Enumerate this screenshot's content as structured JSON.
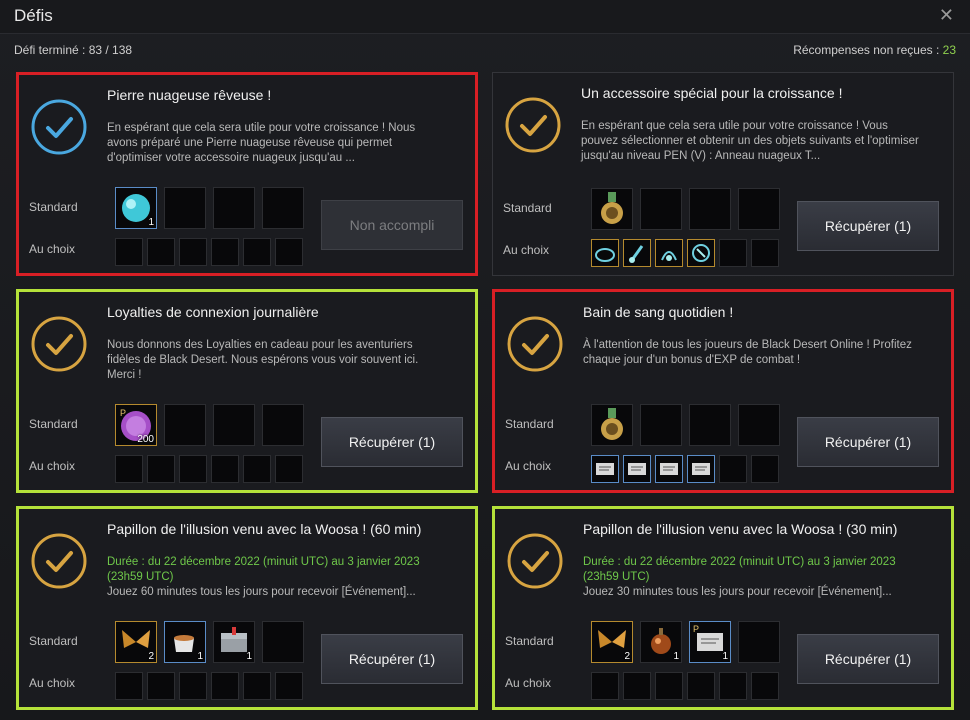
{
  "window": {
    "title": "Défis",
    "close_icon": "close-icon"
  },
  "status": {
    "completed": "Défi terminé : 83 / 138",
    "unclaimed_label": "Récompenses non reçues : ",
    "unclaimed_count": "23"
  },
  "labels": {
    "standard": "Standard",
    "choice": "Au choix"
  },
  "colors": {
    "highlight_red": "#d81f25",
    "highlight_green": "#b5e23a",
    "check_gold": "#d7a441",
    "check_blue": "#4aa8e0",
    "duration_green": "#6fc84a"
  },
  "cards": [
    {
      "title": "Pierre nuageuse rêveuse !",
      "desc": "En espérant que cela sera utile pour votre croissance ! Nous avons préparé une Pierre nuageuse rêveuse qui permet d'optimiser votre accessoire nuageux jusqu'au ...",
      "button": "Non accompli",
      "standard_items": [
        {
          "icon": "cloud-stone-icon",
          "qty": "1"
        }
      ],
      "choice_items": []
    },
    {
      "title": "Un accessoire spécial pour la croissance !",
      "desc": "En espérant que cela sera utile pour votre croissance ! Vous pouvez sélectionner et obtenir un des objets suivants et l'optimiser jusqu'au niveau PEN (V) : Anneau nuageux T...",
      "button": "Récupérer (1)",
      "standard_items": [
        {
          "icon": "medal-icon",
          "qty": ""
        }
      ],
      "choice_items": [
        {
          "icon": "ring-icon"
        },
        {
          "icon": "earring-icon"
        },
        {
          "icon": "necklace-icon"
        },
        {
          "icon": "belt-icon"
        }
      ]
    },
    {
      "title": "Loyalties de connexion journalière",
      "desc": "Nous donnons des Loyalties en cadeau pour les aventuriers fidèles de Black Desert. Nous espérons vous voir souvent ici. Merci !",
      "button": "Récupérer (1)",
      "standard_items": [
        {
          "icon": "loyalty-coin-icon",
          "qty": "200"
        }
      ],
      "choice_items": []
    },
    {
      "title": "Bain de sang quotidien !",
      "desc": "À l'attention de tous les joueurs de Black Desert Online ! Profitez chaque jour d'un bonus d'EXP de combat !",
      "button": "Récupérer (1)",
      "standard_items": [
        {
          "icon": "medal-icon",
          "qty": ""
        }
      ],
      "choice_items": [
        {
          "icon": "scroll-icon"
        },
        {
          "icon": "scroll-icon"
        },
        {
          "icon": "scroll-icon"
        },
        {
          "icon": "scroll-icon"
        }
      ]
    },
    {
      "title": "Papillon de l'illusion venu avec la Woosa ! (60 min)",
      "duration_label": "Durée : ",
      "duration": "du 22 décembre 2022 (minuit UTC) au 3 janvier 2023 (23h59 UTC)",
      "desc": "Jouez 60 minutes tous les jours pour recevoir [Événement]...",
      "button": "Récupérer (1)",
      "standard_items": [
        {
          "icon": "butterfly-icon",
          "qty": "2"
        },
        {
          "icon": "tea-cup-icon",
          "qty": "1"
        },
        {
          "icon": "chest-icon",
          "qty": "1"
        }
      ],
      "choice_items": []
    },
    {
      "title": "Papillon de l'illusion venu avec la Woosa ! (30 min)",
      "duration_label": "Durée : ",
      "duration": "du 22 décembre 2022 (minuit UTC) au 3 janvier 2023 (23h59 UTC)",
      "desc": "Jouez 30 minutes tous les jours pour recevoir [Événement]...",
      "button": "Récupérer (1)",
      "standard_items": [
        {
          "icon": "butterfly-icon",
          "qty": "2"
        },
        {
          "icon": "elixir-icon",
          "qty": "1"
        },
        {
          "icon": "scroll-icon",
          "qty": "1"
        }
      ],
      "choice_items": []
    }
  ]
}
